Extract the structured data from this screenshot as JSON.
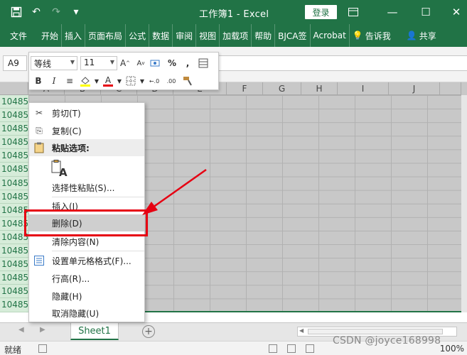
{
  "titlebar": {
    "title": "工作簿1 - Excel",
    "login_label": "登录",
    "min_glyph": "—",
    "max_glyph": "☐",
    "close_glyph": "✕",
    "save_glyph": "💾",
    "undo_glyph": "↶",
    "redo_glyph": "↷",
    "customize_glyph": "▾"
  },
  "ribbon": {
    "tabs": [
      "文件",
      "开始",
      "插入",
      "页面布局",
      "公式",
      "数据",
      "审阅",
      "视图",
      "加载项",
      "帮助",
      "BJCA签",
      "Acrobat",
      "告诉我",
      "共享"
    ]
  },
  "formula_bar": {
    "name_box": "A9"
  },
  "mini_toolbar": {
    "font_name": "等线",
    "font_size": "11",
    "grow_font": "A",
    "shrink_font": "A",
    "percent": "%",
    "comma": ",",
    "bold": "B",
    "italic": "I",
    "align": "≡",
    "font_color": "A",
    "dec_inc": "←.0",
    "dec_dec": ".00"
  },
  "grid": {
    "columns": [
      "A",
      "B",
      "C",
      "D",
      "E",
      "F",
      "G",
      "H",
      "I",
      "J"
    ],
    "row_headers": [
      "1048561",
      "1048562",
      "1048563",
      "1048564",
      "1048565",
      "1048566",
      "1048567",
      "1048568",
      "1048569",
      "1048570",
      "1048571",
      "1048572",
      "1048573",
      "1048574",
      "1048575",
      "1048576"
    ]
  },
  "context_menu": {
    "items": [
      {
        "label": "剪切(T)",
        "icon": "✂"
      },
      {
        "label": "复制(C)",
        "icon": "⎘"
      },
      {
        "label": "粘贴选项:",
        "icon": "📋"
      },
      {
        "label": "选择性粘贴(S)...",
        "icon": ""
      },
      {
        "label": "插入(I)",
        "icon": ""
      },
      {
        "label": "删除(D)",
        "icon": ""
      },
      {
        "label": "清除内容(N)",
        "icon": ""
      },
      {
        "label": "设置单元格格式(F)...",
        "icon": "▤"
      },
      {
        "label": "行高(R)...",
        "icon": ""
      },
      {
        "label": "隐藏(H)",
        "icon": ""
      },
      {
        "label": "取消隐藏(U)",
        "icon": ""
      }
    ],
    "paste_icon_letter": "A"
  },
  "sheets": {
    "active": "Sheet1",
    "add_glyph": "+"
  },
  "status": {
    "text": "就绪",
    "zoom": "100%"
  },
  "watermark": "CSDN @joyce168998",
  "colors": {
    "excel_green": "#217346",
    "highlight_red": "#e60012"
  }
}
